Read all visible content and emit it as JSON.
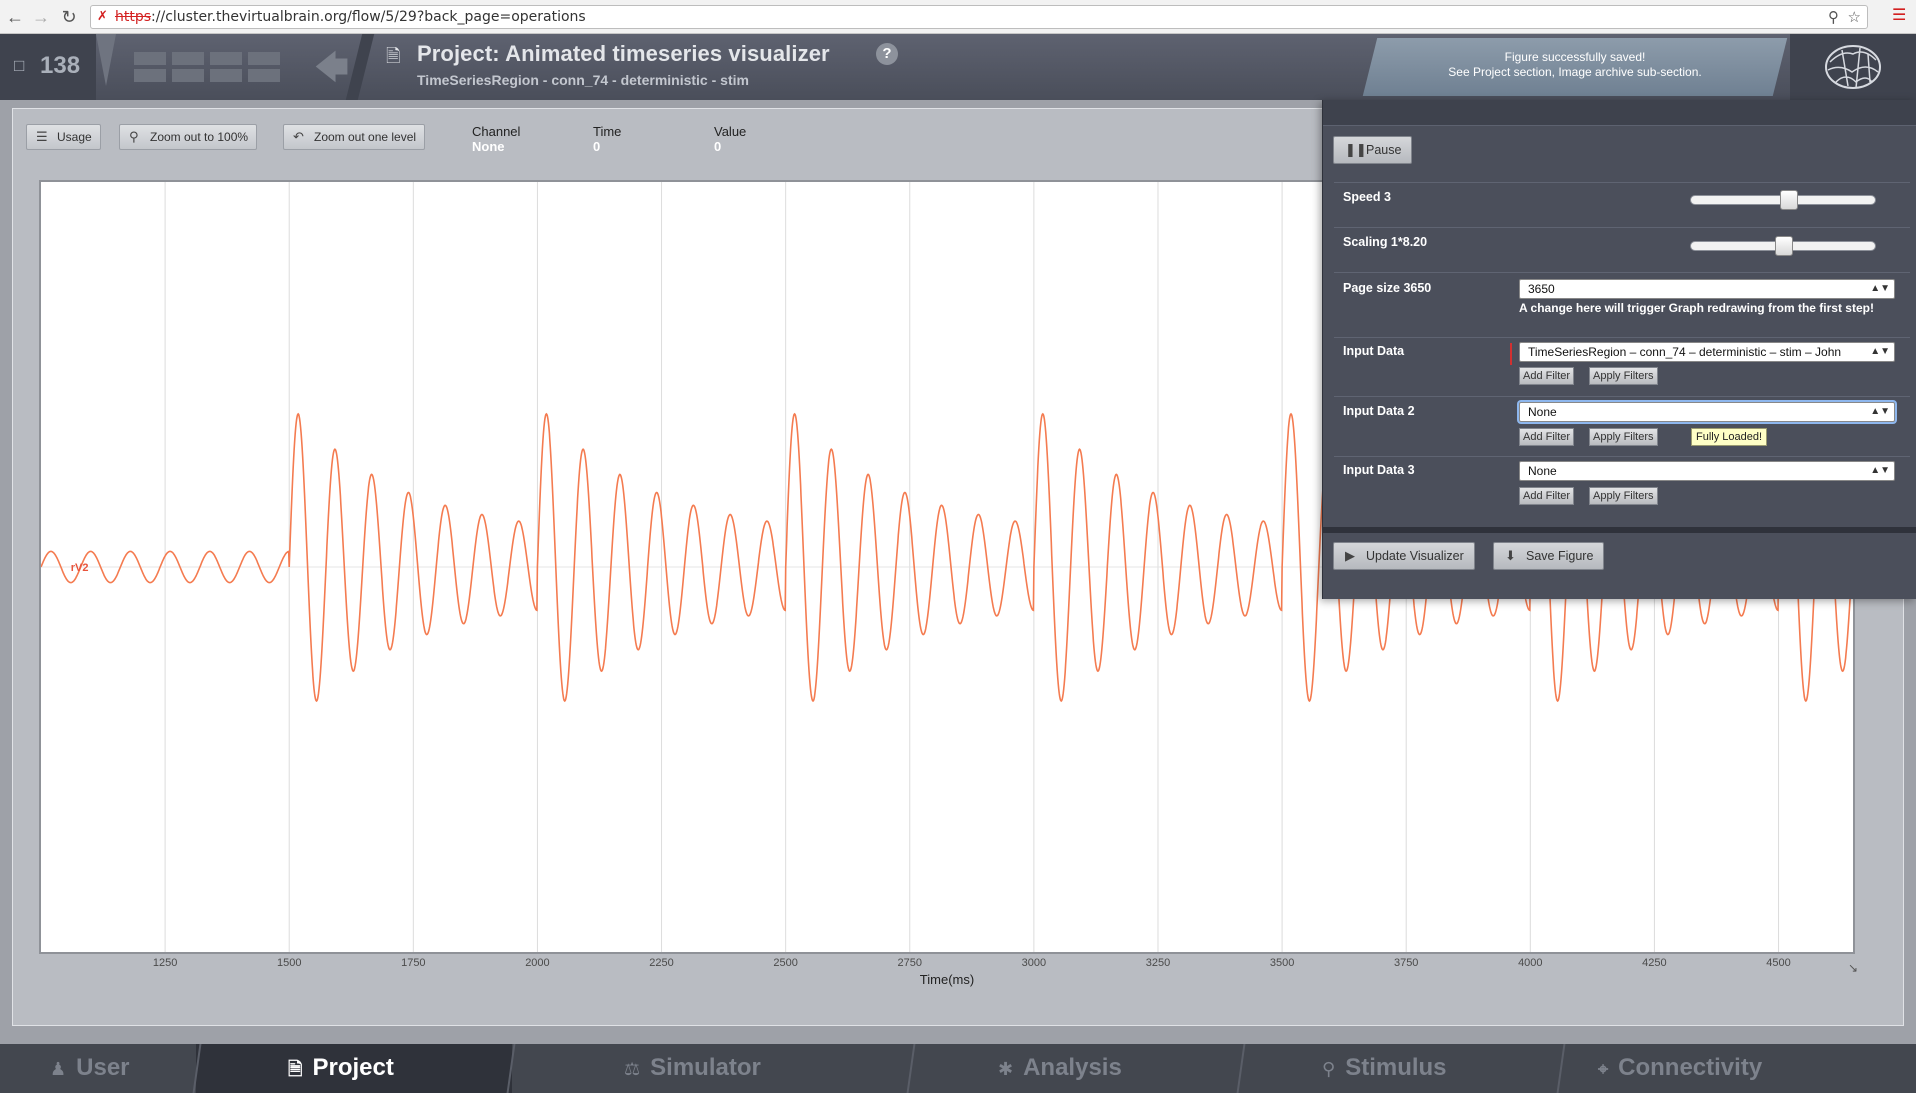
{
  "browser": {
    "url_scheme": "https",
    "url_rest": "://cluster.thevirtualbrain.org/flow/5/29?back_page=operations"
  },
  "header": {
    "operation_count": "138",
    "project_title": "Project: Animated timeseries visualizer",
    "subtitle": "TimeSeriesRegion - conn_74 - deterministic - stim",
    "help": "?",
    "notification_line1": "Figure successfully saved!",
    "notification_line2": "See Project section, Image archive sub-section."
  },
  "toolbar": {
    "usage_label": "Usage",
    "zoom_100_label": "Zoom out to 100%",
    "zoom_level_label": "Zoom out one level",
    "channel_label": "Channel",
    "channel_value": "None",
    "time_label": "Time",
    "time_value": "0",
    "value_label": "Value",
    "value_value": "0"
  },
  "controls": {
    "pause_label": "Pause",
    "speed_label": "Speed 3",
    "speed_value": 0.53,
    "scaling_label": "Scaling 1*8.20",
    "scaling_value": 0.5,
    "page_size_label": "Page size 3650",
    "page_size_value": "3650",
    "page_size_note": "A change here will trigger Graph redrawing from the first step!",
    "input_data_label": "Input Data",
    "input_data_value": "TimeSeriesRegion – conn_74 – deterministic – stim – John",
    "input_data2_label": "Input Data 2",
    "input_data2_value": "None",
    "input_data3_label": "Input Data 3",
    "input_data3_value": "None",
    "add_filter_label": "Add Filter",
    "apply_filters_label": "Apply Filters",
    "fully_loaded_label": "Fully Loaded!",
    "update_label": "Update Visualizer",
    "save_label": "Save Figure"
  },
  "chart_data": {
    "type": "line",
    "xlabel": "Time(ms)",
    "ylabel": "",
    "xlim": [
      1000,
      4650
    ],
    "ylim": [
      -1,
      1
    ],
    "x_ticks": [
      1250,
      1500,
      1750,
      2000,
      2250,
      2500,
      2750,
      3000,
      3250,
      3500,
      3750,
      4000,
      4250,
      4500
    ],
    "grid": true,
    "series": [
      {
        "name": "rV2",
        "color": "#f47b50",
        "stimulus_onsets_ms": [
          1500,
          2000,
          2500,
          3000,
          3500,
          4000,
          4500
        ],
        "stimulus_period_ms": 500,
        "peak_amplitude": 1.0,
        "baseline_amplitude": 0.04
      }
    ]
  },
  "nav": {
    "user": "User",
    "project": "Project",
    "simulator": "Simulator",
    "analysis": "Analysis",
    "stimulus": "Stimulus",
    "connectivity": "Connectivity"
  }
}
